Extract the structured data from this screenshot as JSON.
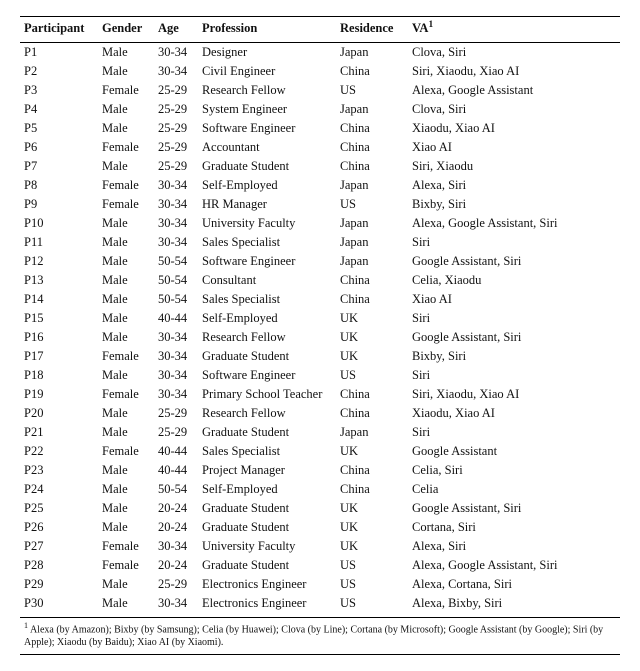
{
  "headers": {
    "participant": "Participant",
    "gender": "Gender",
    "age": "Age",
    "profession": "Profession",
    "residence": "Residence",
    "va": "VA",
    "va_sup": "1"
  },
  "rows": [
    {
      "p": "P1",
      "g": "Male",
      "a": "30-34",
      "prof": "Designer",
      "r": "Japan",
      "va": "Clova, Siri"
    },
    {
      "p": "P2",
      "g": "Male",
      "a": "30-34",
      "prof": "Civil Engineer",
      "r": "China",
      "va": "Siri, Xiaodu, Xiao AI"
    },
    {
      "p": "P3",
      "g": "Female",
      "a": "25-29",
      "prof": "Research Fellow",
      "r": "US",
      "va": "Alexa, Google Assistant"
    },
    {
      "p": "P4",
      "g": "Male",
      "a": "25-29",
      "prof": "System Engineer",
      "r": "Japan",
      "va": "Clova, Siri"
    },
    {
      "p": "P5",
      "g": "Male",
      "a": "25-29",
      "prof": "Software Engineer",
      "r": "China",
      "va": "Xiaodu, Xiao AI"
    },
    {
      "p": "P6",
      "g": "Female",
      "a": "25-29",
      "prof": "Accountant",
      "r": "China",
      "va": "Xiao AI"
    },
    {
      "p": "P7",
      "g": "Male",
      "a": "25-29",
      "prof": "Graduate Student",
      "r": "China",
      "va": "Siri, Xiaodu"
    },
    {
      "p": "P8",
      "g": "Female",
      "a": "30-34",
      "prof": "Self-Employed",
      "r": "Japan",
      "va": "Alexa, Siri"
    },
    {
      "p": "P9",
      "g": "Female",
      "a": "30-34",
      "prof": "HR Manager",
      "r": "US",
      "va": "Bixby, Siri"
    },
    {
      "p": "P10",
      "g": "Male",
      "a": "30-34",
      "prof": "University Faculty",
      "r": "Japan",
      "va": "Alexa, Google Assistant, Siri"
    },
    {
      "p": "P11",
      "g": "Male",
      "a": "30-34",
      "prof": "Sales Specialist",
      "r": "Japan",
      "va": "Siri"
    },
    {
      "p": "P12",
      "g": "Male",
      "a": "50-54",
      "prof": "Software Engineer",
      "r": "Japan",
      "va": "Google Assistant, Siri"
    },
    {
      "p": "P13",
      "g": "Male",
      "a": "50-54",
      "prof": "Consultant",
      "r": "China",
      "va": "Celia, Xiaodu"
    },
    {
      "p": "P14",
      "g": "Male",
      "a": "50-54",
      "prof": "Sales Specialist",
      "r": "China",
      "va": "Xiao AI"
    },
    {
      "p": "P15",
      "g": "Male",
      "a": "40-44",
      "prof": "Self-Employed",
      "r": "UK",
      "va": "Siri"
    },
    {
      "p": "P16",
      "g": "Male",
      "a": "30-34",
      "prof": "Research Fellow",
      "r": "UK",
      "va": "Google Assistant, Siri"
    },
    {
      "p": "P17",
      "g": "Female",
      "a": "30-34",
      "prof": "Graduate Student",
      "r": "UK",
      "va": "Bixby, Siri"
    },
    {
      "p": "P18",
      "g": "Male",
      "a": "30-34",
      "prof": "Software Engineer",
      "r": "US",
      "va": "Siri"
    },
    {
      "p": "P19",
      "g": "Female",
      "a": "30-34",
      "prof": "Primary School Teacher",
      "r": "China",
      "va": "Siri, Xiaodu, Xiao AI"
    },
    {
      "p": "P20",
      "g": "Male",
      "a": "25-29",
      "prof": "Research Fellow",
      "r": "China",
      "va": "Xiaodu, Xiao AI"
    },
    {
      "p": "P21",
      "g": "Male",
      "a": "25-29",
      "prof": "Graduate Student",
      "r": "Japan",
      "va": "Siri"
    },
    {
      "p": "P22",
      "g": "Female",
      "a": "40-44",
      "prof": "Sales Specialist",
      "r": "UK",
      "va": "Google Assistant"
    },
    {
      "p": "P23",
      "g": "Male",
      "a": "40-44",
      "prof": "Project Manager",
      "r": "China",
      "va": "Celia, Siri"
    },
    {
      "p": "P24",
      "g": "Male",
      "a": "50-54",
      "prof": "Self-Employed",
      "r": "China",
      "va": "Celia"
    },
    {
      "p": "P25",
      "g": "Male",
      "a": "20-24",
      "prof": "Graduate Student",
      "r": "UK",
      "va": "Google Assistant, Siri"
    },
    {
      "p": "P26",
      "g": "Male",
      "a": "20-24",
      "prof": "Graduate Student",
      "r": "UK",
      "va": "Cortana, Siri"
    },
    {
      "p": "P27",
      "g": "Female",
      "a": "30-34",
      "prof": "University Faculty",
      "r": "UK",
      "va": "Alexa, Siri"
    },
    {
      "p": "P28",
      "g": "Female",
      "a": "20-24",
      "prof": "Graduate Student",
      "r": "US",
      "va": "Alexa, Google Assistant, Siri"
    },
    {
      "p": "P29",
      "g": "Male",
      "a": "25-29",
      "prof": "Electronics Engineer",
      "r": "US",
      "va": "Alexa, Cortana, Siri"
    },
    {
      "p": "P30",
      "g": "Male",
      "a": "30-34",
      "prof": "Electronics Engineer",
      "r": "US",
      "va": "Alexa, Bixby, Siri"
    }
  ],
  "footnote": {
    "marker": "1",
    "text": "Alexa (by Amazon); Bixby (by Samsung); Celia (by Huawei); Clova (by Line); Cortana (by Microsoft); Google Assistant (by Google); Siri (by Apple); Xiaodu (by Baidu); Xiao AI (by Xiaomi)."
  },
  "chart_data": {
    "type": "table",
    "columns": [
      "Participant",
      "Gender",
      "Age",
      "Profession",
      "Residence",
      "VA"
    ],
    "rows": [
      [
        "P1",
        "Male",
        "30-34",
        "Designer",
        "Japan",
        "Clova, Siri"
      ],
      [
        "P2",
        "Male",
        "30-34",
        "Civil Engineer",
        "China",
        "Siri, Xiaodu, Xiao AI"
      ],
      [
        "P3",
        "Female",
        "25-29",
        "Research Fellow",
        "US",
        "Alexa, Google Assistant"
      ],
      [
        "P4",
        "Male",
        "25-29",
        "System Engineer",
        "Japan",
        "Clova, Siri"
      ],
      [
        "P5",
        "Male",
        "25-29",
        "Software Engineer",
        "China",
        "Xiaodu, Xiao AI"
      ],
      [
        "P6",
        "Female",
        "25-29",
        "Accountant",
        "China",
        "Xiao AI"
      ],
      [
        "P7",
        "Male",
        "25-29",
        "Graduate Student",
        "China",
        "Siri, Xiaodu"
      ],
      [
        "P8",
        "Female",
        "30-34",
        "Self-Employed",
        "Japan",
        "Alexa, Siri"
      ],
      [
        "P9",
        "Female",
        "30-34",
        "HR Manager",
        "US",
        "Bixby, Siri"
      ],
      [
        "P10",
        "Male",
        "30-34",
        "University Faculty",
        "Japan",
        "Alexa, Google Assistant, Siri"
      ],
      [
        "P11",
        "Male",
        "30-34",
        "Sales Specialist",
        "Japan",
        "Siri"
      ],
      [
        "P12",
        "Male",
        "50-54",
        "Software Engineer",
        "Japan",
        "Google Assistant, Siri"
      ],
      [
        "P13",
        "Male",
        "50-54",
        "Consultant",
        "China",
        "Celia, Xiaodu"
      ],
      [
        "P14",
        "Male",
        "50-54",
        "Sales Specialist",
        "China",
        "Xiao AI"
      ],
      [
        "P15",
        "Male",
        "40-44",
        "Self-Employed",
        "UK",
        "Siri"
      ],
      [
        "P16",
        "Male",
        "30-34",
        "Research Fellow",
        "UK",
        "Google Assistant, Siri"
      ],
      [
        "P17",
        "Female",
        "30-34",
        "Graduate Student",
        "UK",
        "Bixby, Siri"
      ],
      [
        "P18",
        "Male",
        "30-34",
        "Software Engineer",
        "US",
        "Siri"
      ],
      [
        "P19",
        "Female",
        "30-34",
        "Primary School Teacher",
        "China",
        "Siri, Xiaodu, Xiao AI"
      ],
      [
        "P20",
        "Male",
        "25-29",
        "Research Fellow",
        "China",
        "Xiaodu, Xiao AI"
      ],
      [
        "P21",
        "Male",
        "25-29",
        "Graduate Student",
        "Japan",
        "Siri"
      ],
      [
        "P22",
        "Female",
        "40-44",
        "Sales Specialist",
        "UK",
        "Google Assistant"
      ],
      [
        "P23",
        "Male",
        "40-44",
        "Project Manager",
        "China",
        "Celia, Siri"
      ],
      [
        "P24",
        "Male",
        "50-54",
        "Self-Employed",
        "China",
        "Celia"
      ],
      [
        "P25",
        "Male",
        "20-24",
        "Graduate Student",
        "UK",
        "Google Assistant, Siri"
      ],
      [
        "P26",
        "Male",
        "20-24",
        "Graduate Student",
        "UK",
        "Cortana, Siri"
      ],
      [
        "P27",
        "Female",
        "30-34",
        "University Faculty",
        "UK",
        "Alexa, Siri"
      ],
      [
        "P28",
        "Female",
        "20-24",
        "Graduate Student",
        "US",
        "Alexa, Google Assistant, Siri"
      ],
      [
        "P29",
        "Male",
        "25-29",
        "Electronics Engineer",
        "US",
        "Alexa, Cortana, Siri"
      ],
      [
        "P30",
        "Male",
        "30-34",
        "Electronics Engineer",
        "US",
        "Alexa, Bixby, Siri"
      ]
    ]
  }
}
